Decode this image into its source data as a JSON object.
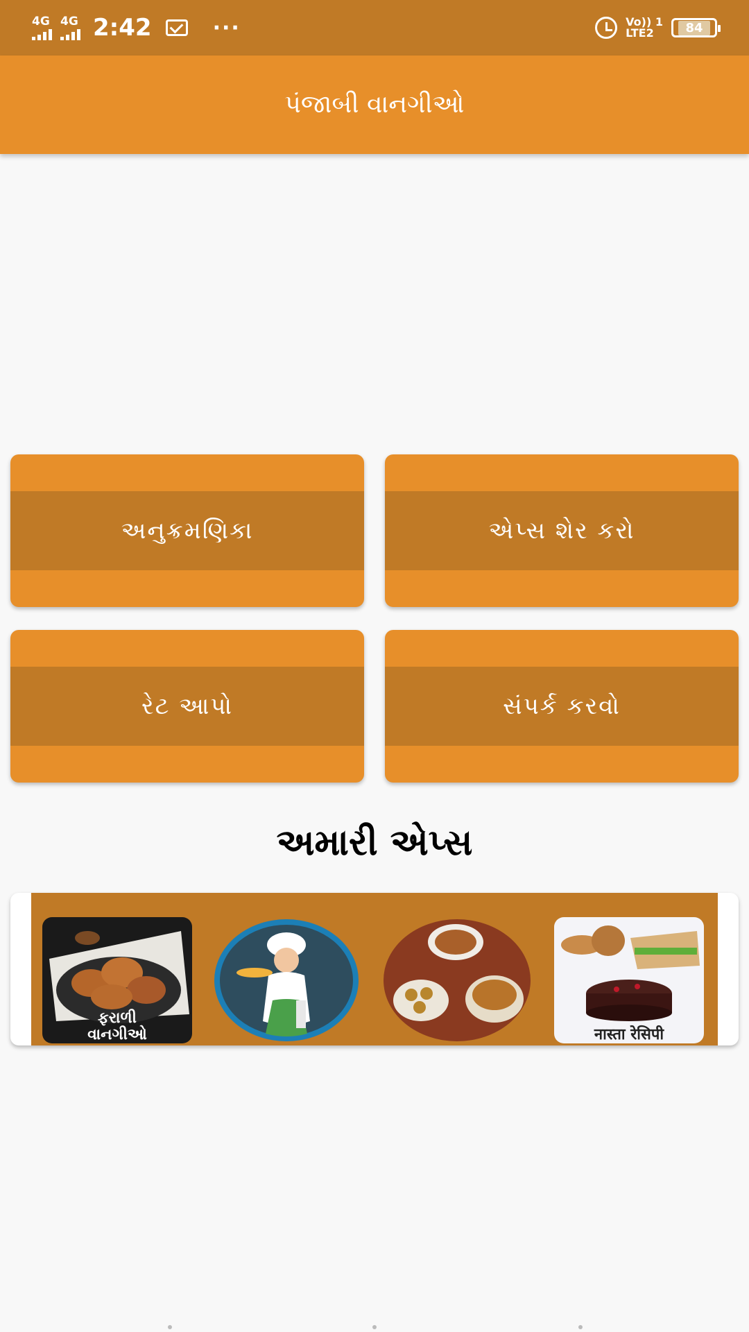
{
  "status_bar": {
    "network_1": "4G",
    "network_2": "4G",
    "time": "2:42",
    "more": "···",
    "volte_top": "Vo)) 1",
    "volte_bottom": "LTE2",
    "battery": "84"
  },
  "app_bar": {
    "title": "પંજાબી વાનગીઓ"
  },
  "menu": [
    {
      "label": "અનુક્રમણિકા"
    },
    {
      "label": "એપ્સ શેર કરો"
    },
    {
      "label": "રેટ આપો"
    },
    {
      "label": "સંપર્ક કરવો"
    }
  ],
  "our_apps": {
    "title": "અમારી એપ્સ",
    "apps": [
      {
        "label_line1": "ફરાળી",
        "label_line2": "વાનગીઓ",
        "icon": "farali-food-icon"
      },
      {
        "icon": "chef-icon"
      },
      {
        "icon": "curry-bowls-icon"
      },
      {
        "label_line1": "नास्ता रेसिपी",
        "icon": "snacks-cake-icon"
      }
    ]
  },
  "colors": {
    "primary": "#e78f2a",
    "primary_dark": "#c07a26",
    "background": "#f8f8f8"
  }
}
